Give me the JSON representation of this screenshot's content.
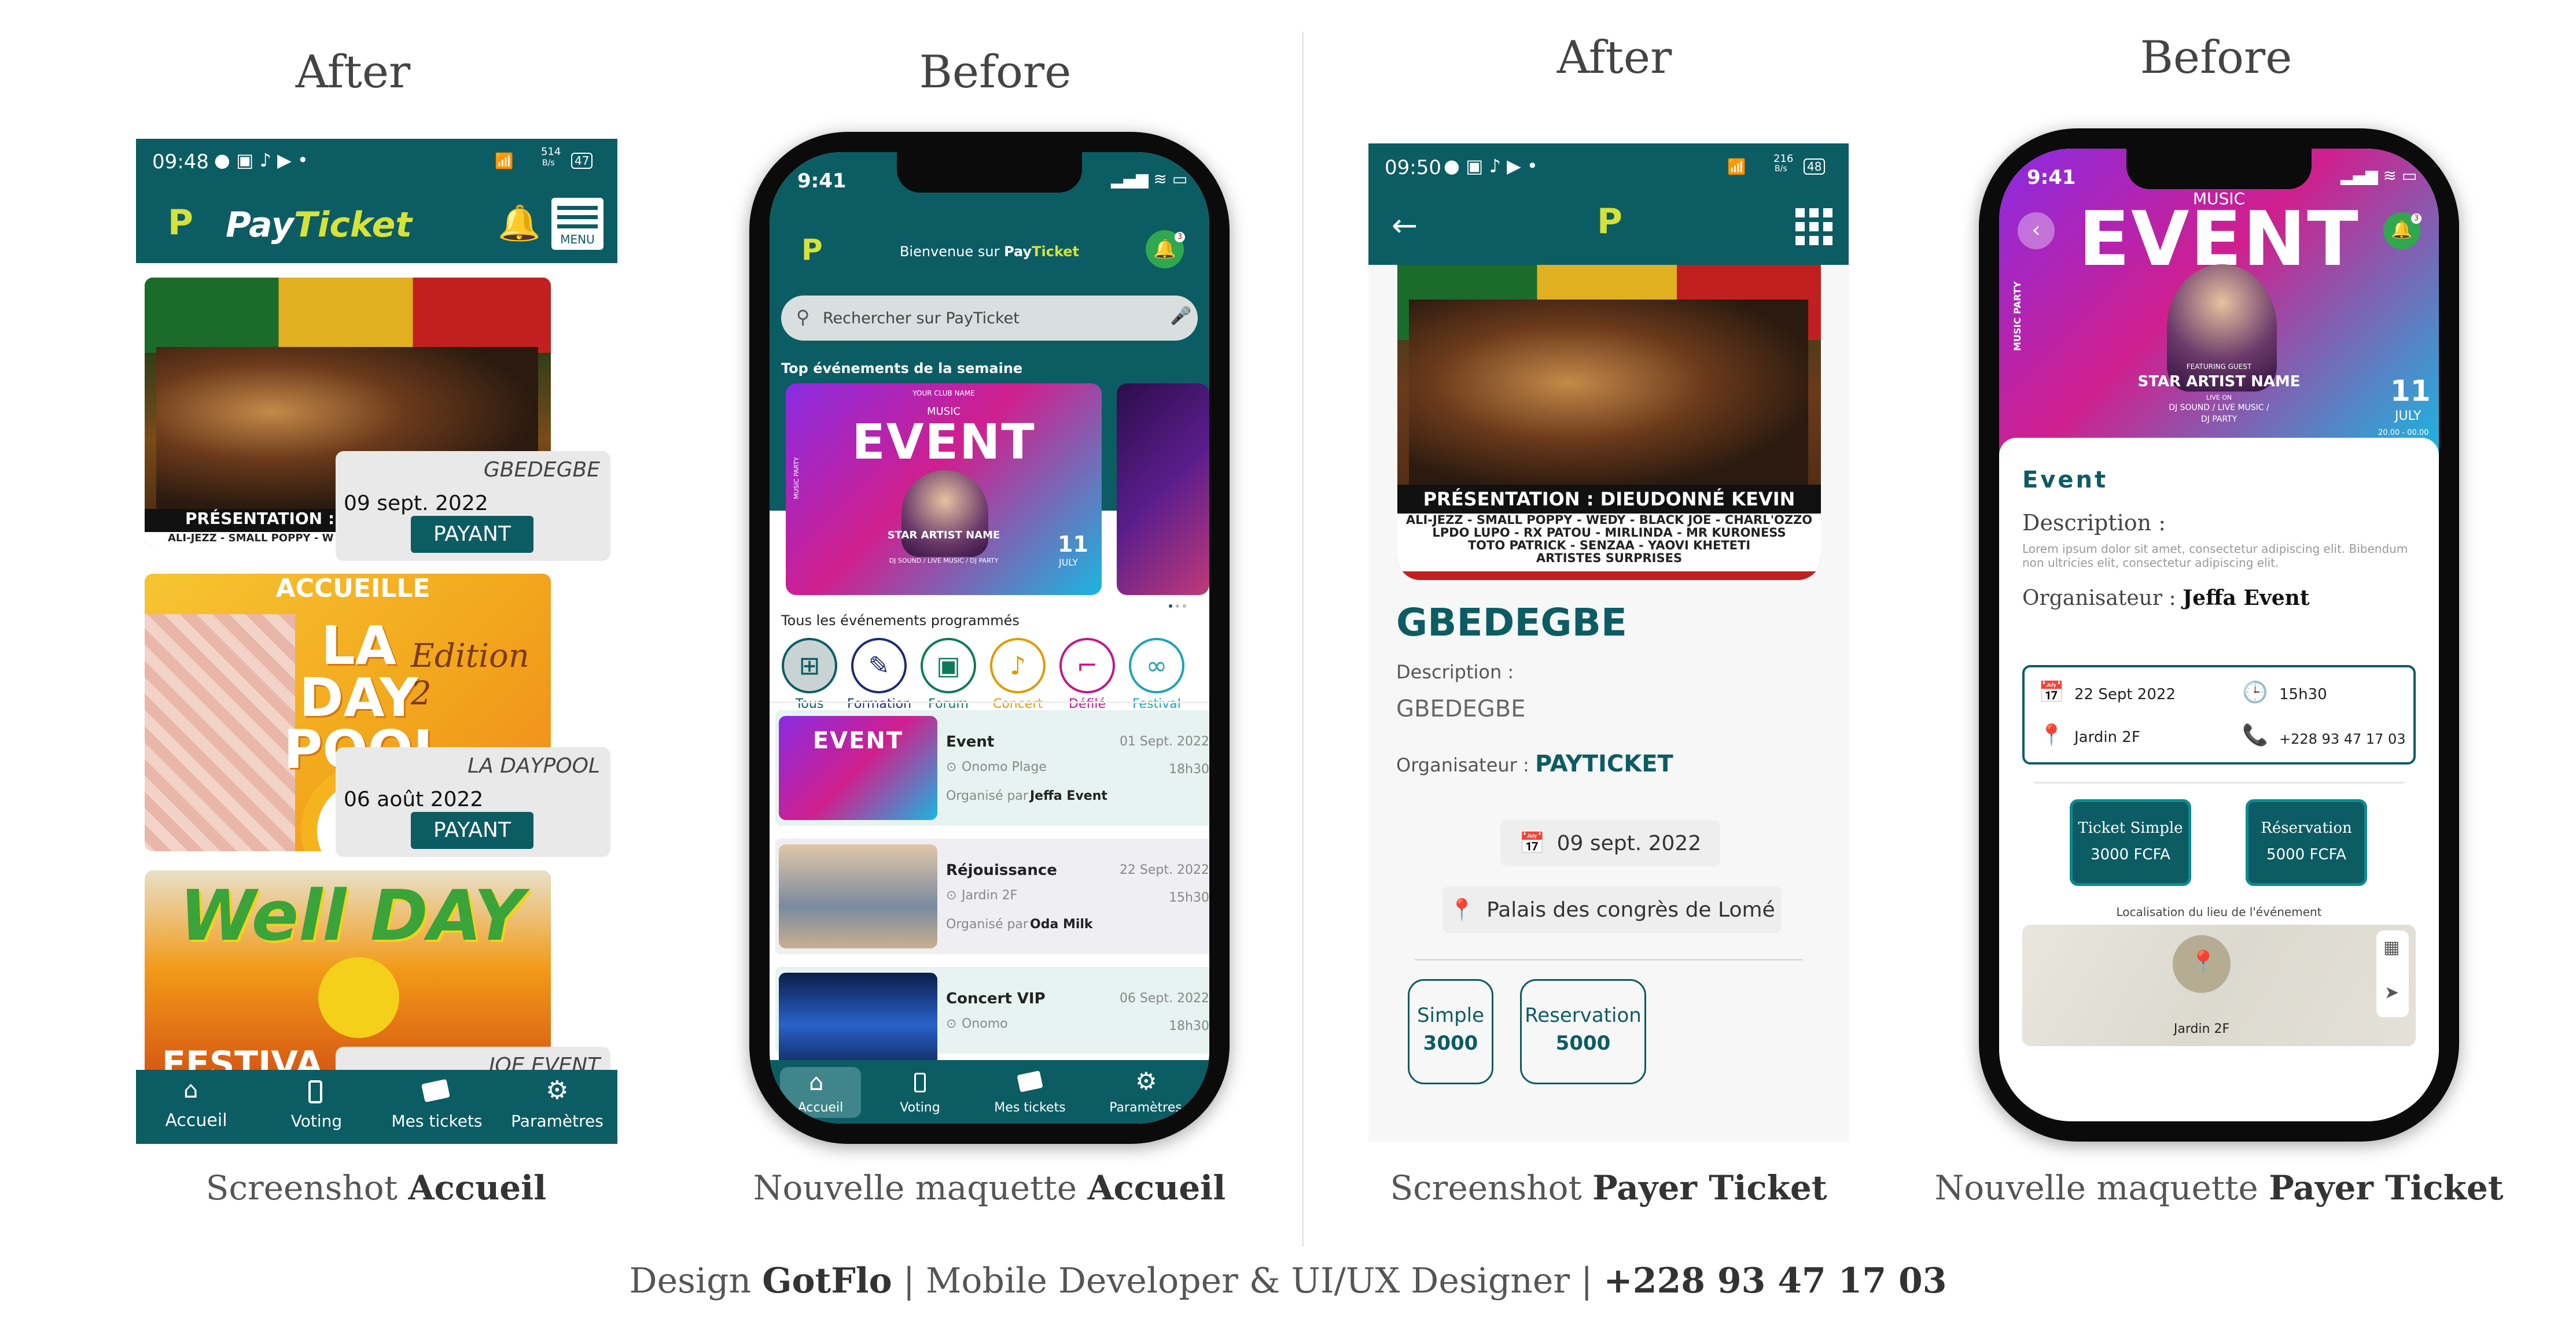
{
  "headings": {
    "col1": "After",
    "col2": "Before",
    "col3": "After",
    "col4": "Before"
  },
  "captions": {
    "c1_pre": "Screenshot ",
    "c1_bold": "Accueil",
    "c2_pre": "Nouvelle maquette ",
    "c2_bold": "Accueil",
    "c3_pre": "Screenshot ",
    "c3_bold": "Payer Ticket",
    "c4_pre": "Nouvelle maquette ",
    "c4_bold": "Payer Ticket"
  },
  "footer": {
    "pre": "Design ",
    "brand": "GotFlo",
    "rest": " | Mobile Developer & UI/UX Designer | ",
    "phone": "+228 93 47 17 03"
  },
  "screen1": {
    "status_time": "09:48",
    "status_speed": "514",
    "status_unit": "B/s",
    "status_battery": "47",
    "app_logo": "P",
    "app_name_a": "Pay",
    "app_name_b": "Ticket",
    "menu_label": "MENU",
    "events": [
      {
        "name": "GBEDEGBE",
        "date": "09 sept. 2022",
        "button": "PAYANT",
        "poster_caption": "PRÉSENTATION : D",
        "poster_sub": "ALI-JEZZ - SMALL POPPY - W"
      },
      {
        "name": "LA DAYPOOL",
        "date": "06 août 2022",
        "button": "PAYANT",
        "poster_caption": "ACCUEILLE",
        "poster_title": "LA DAY POOL",
        "poster_edition": "Edition 2"
      },
      {
        "name": "JOE EVENT",
        "poster_title": "Well DAY",
        "poster_caption": "FESTIVA"
      }
    ],
    "nav": [
      "Accueil",
      "Voting",
      "Mes tickets",
      "Paramètres"
    ]
  },
  "screen2": {
    "status_time": "9:41",
    "welcome_pre": "Bienvenue sur ",
    "welcome_pay": "Pay",
    "welcome_ticket": "Ticket",
    "notif_count": "3",
    "search_placeholder": "Rechercher sur PayTicket",
    "top_title": "Top événements de la semaine",
    "banner": {
      "small": "YOUR CLUB NAME",
      "music": "MUSIC",
      "event": "EVENT",
      "artist": "STAR ARTIST NAME",
      "sub": "DJ SOUND / LIVE MUSIC / DJ PARTY",
      "day": "11",
      "month": "JULY",
      "side": "MUSIC PARTY"
    },
    "all_title": "Tous les événements programmés",
    "categories": [
      {
        "label": "Tous",
        "color": "#0c5c63",
        "icon": "grid-icon"
      },
      {
        "label": "Formation",
        "color": "#1e2a78",
        "icon": "edit-icon"
      },
      {
        "label": "Forum",
        "color": "#0c7a5a",
        "icon": "briefcase-icon"
      },
      {
        "label": "Concert",
        "color": "#e09a00",
        "icon": "music-icon"
      },
      {
        "label": "Défilé",
        "color": "#c0178a",
        "icon": "heel-icon"
      },
      {
        "label": "Festival",
        "color": "#1aa3b8",
        "icon": "mask-icon"
      }
    ],
    "list": [
      {
        "title": "Event",
        "date": "01 Sept. 2022",
        "place": "Onomo Plage",
        "time": "18h30",
        "org_pre": "Organisé par ",
        "org": "Jeffa Event"
      },
      {
        "title": "Réjouissance",
        "date": "22 Sept. 2022",
        "place": "Jardin 2F",
        "time": "15h30",
        "org_pre": "Organisé par ",
        "org": "Oda Milk"
      },
      {
        "title": "Concert VIP",
        "date": "06 Sept. 2022",
        "place": "Onomo",
        "time": "18h30"
      }
    ],
    "thumb_event": "EVENT",
    "nav": [
      "Accueil",
      "Voting",
      "Mes tickets",
      "Paramètres"
    ]
  },
  "screen3": {
    "status_time": "09:50",
    "status_speed": "216",
    "status_unit": "B/s",
    "status_battery": "48",
    "poster_caption": "PRÉSENTATION : DIEUDONNÉ KEVIN",
    "poster_lines": [
      "ALI-JEZZ - SMALL POPPY - WEDY - BLACK JOE - CHARL'OZZO",
      "LPDO LUPO - RX PATOU - MIRLINDA - MR KURONESS",
      "TOTO PATRICK - SENZAA - YAOVI KHETETI",
      "ARTISTES SURPRISES"
    ],
    "title": "GBEDEGBE",
    "desc_label": "Description :",
    "desc_value": "GBEDEGBE",
    "org_label": "Organisateur : ",
    "org_value": "PAYTICKET",
    "date": "09 sept. 2022",
    "place": "Palais des congrès de Lomé",
    "tickets": [
      {
        "name": "Simple",
        "price": "3000"
      },
      {
        "name": "Reservation",
        "price": "5000"
      }
    ]
  },
  "screen4": {
    "status_time": "9:41",
    "music": "MUSIC",
    "event": "EVENT",
    "featuring": "FEATURING GUEST",
    "artist": "STAR ARTIST NAME",
    "live": "LIVE ON",
    "sub1": "DJ SOUND / LIVE MUSIC /",
    "sub2": "DJ PARTY",
    "day": "11",
    "month": "JULY",
    "hours": "20.00 - 00.00",
    "side": "MUSIC PARTY",
    "notif_count": "3",
    "title": "Event",
    "desc_label": "Description :",
    "desc_text": "Lorem ipsum dolor sit amet, consectetur adipiscing elit. Bibendum non ultricies elit, consectetur adipiscing elit.",
    "org_label": "Organisateur : ",
    "org_value": "Jeffa Event",
    "date": "22 Sept 2022",
    "time": "15h30",
    "place": "Jardin 2F",
    "phone": "+228 93 47 17 03",
    "tickets": [
      {
        "name": "Ticket Simple",
        "price": "3000 FCFA"
      },
      {
        "name": "Réservation",
        "price": "5000 FCFA"
      }
    ],
    "map_title": "Localisation du lieu de l'événement",
    "map_pin": "Jardin 2F"
  }
}
